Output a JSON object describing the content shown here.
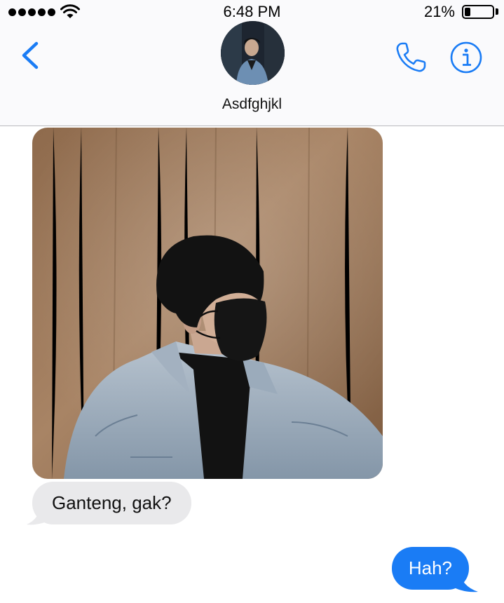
{
  "status_bar": {
    "time": "6:48 PM",
    "battery_percent": "21%",
    "battery_level": 0.21,
    "signal_bars": 5
  },
  "header": {
    "contact_name": "Asdfghjkl",
    "back_icon": "chevron-left-icon",
    "call_icon": "phone-icon",
    "info_icon": "info-icon",
    "accent_color": "#1a7cf5"
  },
  "messages": [
    {
      "direction": "incoming",
      "type": "photo",
      "description": "photo of a person wearing a black face mask and a denim jacket in front of a wooden wall"
    },
    {
      "direction": "incoming",
      "type": "text",
      "text": "Ganteng, gak?"
    },
    {
      "direction": "outgoing",
      "type": "text",
      "text": "Hah?"
    }
  ],
  "colors": {
    "incoming_bubble": "#e9e9eb",
    "outgoing_bubble": "#1a7cf5",
    "header_background": "#fafafc"
  }
}
